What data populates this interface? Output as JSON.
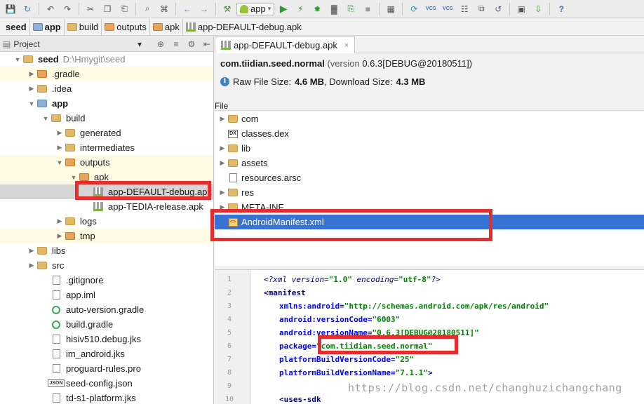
{
  "toolbar": {
    "run_config": "app",
    "vcs_label": "VCS",
    "help": "?"
  },
  "breadcrumb": [
    "seed",
    "app",
    "build",
    "outputs",
    "apk",
    "app-DEFAULT-debug.apk"
  ],
  "project_panel": {
    "title": "Project",
    "view_dropdown": "▾"
  },
  "tree": [
    {
      "label": "seed",
      "extra": "D:\\Hmygit\\seed",
      "depth": 0,
      "arrow": "▼",
      "icon": "folder-icon",
      "bold": true
    },
    {
      "label": ".gradle",
      "depth": 1,
      "arrow": "▶",
      "icon": "folder-orange-icon",
      "hl": true
    },
    {
      "label": ".idea",
      "depth": 1,
      "arrow": "▶",
      "icon": "folder-icon"
    },
    {
      "label": "app",
      "depth": 1,
      "arrow": "▼",
      "icon": "module-folder-icon",
      "bold": true
    },
    {
      "label": "build",
      "depth": 2,
      "arrow": "▼",
      "icon": "folder-icon"
    },
    {
      "label": "generated",
      "depth": 3,
      "arrow": "▶",
      "icon": "folder-icon"
    },
    {
      "label": "intermediates",
      "depth": 3,
      "arrow": "▶",
      "icon": "folder-icon"
    },
    {
      "label": "outputs",
      "depth": 3,
      "arrow": "▼",
      "icon": "folder-orange-icon",
      "hl": true
    },
    {
      "label": "apk",
      "depth": 4,
      "arrow": "▼",
      "icon": "folder-orange-icon",
      "hl": true
    },
    {
      "label": "app-DEFAULT-debug.apk",
      "depth": 5,
      "arrow": "",
      "icon": "apk-icon",
      "selected": true
    },
    {
      "label": "app-TEDIA-release.apk",
      "depth": 5,
      "arrow": "",
      "icon": "apk-icon"
    },
    {
      "label": "logs",
      "depth": 3,
      "arrow": "▶",
      "icon": "folder-icon"
    },
    {
      "label": "tmp",
      "depth": 3,
      "arrow": "▶",
      "icon": "folder-orange-icon",
      "hl": true
    },
    {
      "label": "libs",
      "depth": 1,
      "arrow": "▶",
      "icon": "folder-icon"
    },
    {
      "label": "src",
      "depth": 1,
      "arrow": "▶",
      "icon": "folder-icon"
    },
    {
      "label": ".gitignore",
      "depth": 2,
      "arrow": "",
      "icon": "file-icon"
    },
    {
      "label": "app.iml",
      "depth": 2,
      "arrow": "",
      "icon": "file-icon"
    },
    {
      "label": "auto-version.gradle",
      "depth": 2,
      "arrow": "",
      "icon": "gradle-icon"
    },
    {
      "label": "build.gradle",
      "depth": 2,
      "arrow": "",
      "icon": "gradle-icon"
    },
    {
      "label": "hisiv510.debug.jks",
      "depth": 2,
      "arrow": "",
      "icon": "file-icon"
    },
    {
      "label": "im_android.jks",
      "depth": 2,
      "arrow": "",
      "icon": "file-icon"
    },
    {
      "label": "proguard-rules.pro",
      "depth": 2,
      "arrow": "",
      "icon": "file-icon"
    },
    {
      "label": "seed-config.json",
      "depth": 2,
      "arrow": "",
      "icon": "json-icon"
    },
    {
      "label": "td-s1-platform.jks",
      "depth": 2,
      "arrow": "",
      "icon": "file-icon"
    }
  ],
  "editor_tab": {
    "label": "app-DEFAULT-debug.apk",
    "close": "×"
  },
  "apk_info": {
    "package": "com.tiidian.seed.normal",
    "version_prefix": "(version",
    "version": "0.6.3[DEBUG@20180511])",
    "raw_size_label": "Raw File Size:",
    "raw_size": "4.6 MB",
    "download_label": ", Download Size:",
    "download_size": "4.3 MB"
  },
  "file_header": "File",
  "files": [
    {
      "label": "com",
      "arrow": "▶",
      "icon": "folder-icon"
    },
    {
      "label": "classes.dex",
      "arrow": "",
      "icon": "dex-icon"
    },
    {
      "label": "lib",
      "arrow": "▶",
      "icon": "folder-icon"
    },
    {
      "label": "assets",
      "arrow": "▶",
      "icon": "folder-icon"
    },
    {
      "label": "resources.arsc",
      "arrow": "",
      "icon": "file-icon"
    },
    {
      "label": "res",
      "arrow": "▶",
      "icon": "folder-icon"
    },
    {
      "label": "META-INF",
      "arrow": "▶",
      "icon": "folder-icon"
    },
    {
      "label": "AndroidManifest.xml",
      "arrow": "",
      "icon": "xml-icon",
      "selected": true
    }
  ],
  "code_lines": [
    {
      "n": "1",
      "html": "<span class='pi'>&lt;?xml version=</span><span class='str'>\"1.0\"</span><span class='pi'> encoding=</span><span class='str'>\"utf-8\"</span><span class='pi'>?&gt;</span>",
      "indent": 0
    },
    {
      "n": "2",
      "html": "<span class='tag'>&lt;manifest</span>",
      "indent": 0
    },
    {
      "n": "3",
      "html": "<span class='attr'>xmlns:android=</span><span class='str'>\"http://schemas.android.com/apk/res/android\"</span>",
      "indent": 1
    },
    {
      "n": "4",
      "html": "<span class='attr'>android:versionCode=</span><span class='str'>\"6003\"</span>",
      "indent": 1
    },
    {
      "n": "5",
      "html": "<span class='attr'>android:versionName=</span><span class='str'>\"0.6.3[DEBUG@20180511]\"</span>",
      "indent": 1
    },
    {
      "n": "6",
      "html": "<span class='attr'>package=</span><span class='str'>\"com.tiidian.seed.normal\"</span>",
      "indent": 1
    },
    {
      "n": "7",
      "html": "<span class='attr'>platformBuildVersionCode=</span><span class='str'>\"25\"</span>",
      "indent": 1
    },
    {
      "n": "8",
      "html": "<span class='attr'>platformBuildVersionName=</span><span class='str'>\"7.1.1\"</span><span class='tag'>&gt;</span>",
      "indent": 1
    },
    {
      "n": "9",
      "html": "",
      "indent": 0
    },
    {
      "n": "10",
      "html": "<span class='tag'>&lt;uses-sdk</span>",
      "indent": 1
    }
  ],
  "watermark": "https://blog.csdn.net/changhuzichangchang",
  "colors": {
    "selection": "#3873d4",
    "annotation": "#e52d2d",
    "highlight": "#fffbe5"
  }
}
